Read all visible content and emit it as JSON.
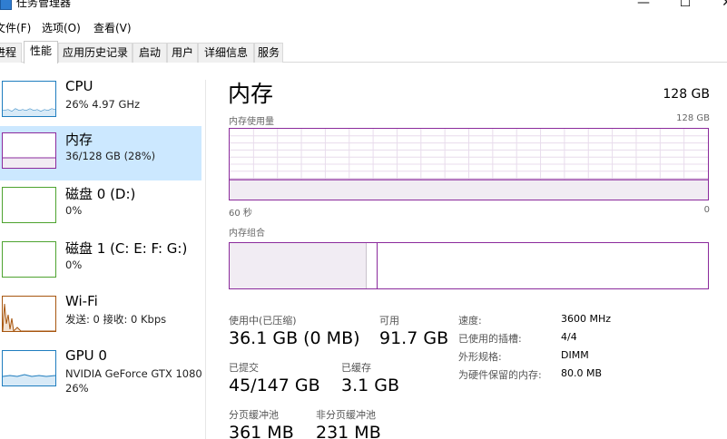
{
  "window": {
    "title": "任务管理器",
    "minimize_glyph": "—",
    "maximize_glyph": "☐",
    "close_glyph": "✕"
  },
  "menu": {
    "file": "文件(F)",
    "options": "选项(O)",
    "view": "查看(V)"
  },
  "tabs": [
    {
      "label": "进程"
    },
    {
      "label": "性能"
    },
    {
      "label": "应用历史记录"
    },
    {
      "label": "启动"
    },
    {
      "label": "用户"
    },
    {
      "label": "详细信息"
    },
    {
      "label": "服务"
    }
  ],
  "active_tab": "性能",
  "resources": [
    {
      "name": "CPU",
      "detail": "26% 4.97 GHz",
      "color": "#1f7dbf"
    },
    {
      "name": "内存",
      "detail": "36/128 GB (28%)",
      "color": "#8b2a9c",
      "selected": true
    },
    {
      "name": "磁盘 0 (D:)",
      "detail": "0%",
      "color": "#4da32f"
    },
    {
      "name": "磁盘 1 (C: E: F: G:)",
      "detail": "0%",
      "color": "#4da32f"
    },
    {
      "name": "Wi-Fi",
      "detail": "发送: 0 接收: 0 Kbps",
      "color": "#a7560f"
    },
    {
      "name": "GPU 0",
      "detail": "NVIDIA GeForce GTX 1080",
      "detail2": "26%",
      "color": "#1f7dbf"
    }
  ],
  "main": {
    "title": "内存",
    "total": "128 GB",
    "usage_graph_label": "内存使用量",
    "usage_graph_max": "128 GB",
    "time_left": "60 秒",
    "time_right": "0",
    "composition_label": "内存组合",
    "memory_usage_fraction": 0.28
  },
  "stats": {
    "in_use_label": "使用中(已压缩)",
    "in_use_value": "36.1 GB (0 MB)",
    "available_label": "可用",
    "available_value": "91.7 GB",
    "committed_label": "已提交",
    "committed_value": "45/147 GB",
    "cached_label": "已缓存",
    "cached_value": "3.1 GB",
    "paged_pool_label": "分页缓冲池",
    "paged_pool_value": "361 MB",
    "nonpaged_pool_label": "非分页缓冲池",
    "nonpaged_pool_value": "231 MB"
  },
  "specs": [
    {
      "label": "速度:",
      "value": "3600 MHz"
    },
    {
      "label": "已使用的插槽:",
      "value": "4/4"
    },
    {
      "label": "外形规格:",
      "value": "DIMM"
    },
    {
      "label": "为硬件保留的内存:",
      "value": "80.0 MB"
    }
  ]
}
